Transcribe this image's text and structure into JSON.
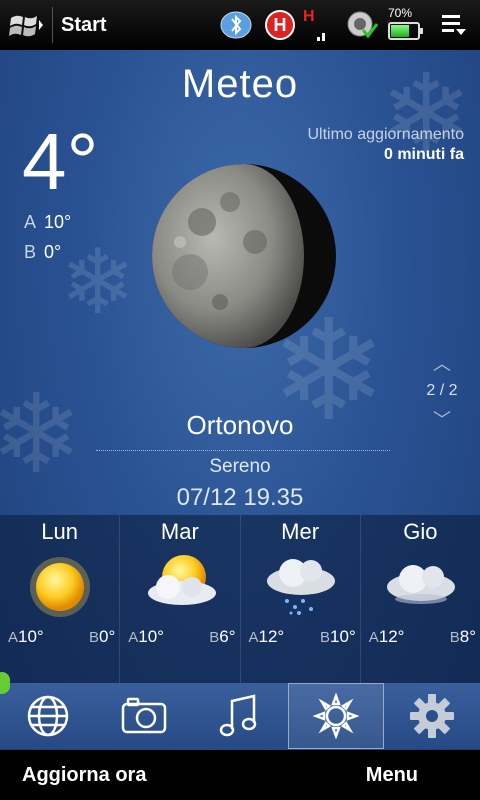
{
  "statusbar": {
    "start_label": "Start",
    "battery_percent": "70%",
    "battery_level": 0.7,
    "icons": [
      "windows-flag-icon",
      "bluetooth-icon",
      "h-signal-icon",
      "signal-bars-icon",
      "sync-icon",
      "battery-icon",
      "menu-icon"
    ]
  },
  "weather": {
    "app_title": "Meteo",
    "current_temp": "4°",
    "high_letter": "A",
    "high": "10°",
    "low_letter": "B",
    "low": "0°",
    "update_label": "Ultimo aggiornamento",
    "update_value": "0 minuti fa",
    "page_indicator": "2 / 2",
    "city": "Ortonovo",
    "condition": "Sereno",
    "datetime": "07/12 19.35"
  },
  "forecast": [
    {
      "day": "Lun",
      "icon": "sun-icon",
      "hi_letter": "A",
      "hi": "10°",
      "lo_letter": "B",
      "lo": "0°"
    },
    {
      "day": "Mar",
      "icon": "partly-cloudy-icon",
      "hi_letter": "A",
      "hi": "10°",
      "lo_letter": "B",
      "lo": "6°"
    },
    {
      "day": "Mer",
      "icon": "rain-cloud-icon",
      "hi_letter": "A",
      "hi": "12°",
      "lo_letter": "B",
      "lo": "10°"
    },
    {
      "day": "Gio",
      "icon": "cloud-icon",
      "hi_letter": "A",
      "hi": "12°",
      "lo_letter": "B",
      "lo": "8°"
    }
  ],
  "iconbar": {
    "items": [
      "globe-icon",
      "camera-icon",
      "music-note-icon",
      "weather-sun-icon",
      "settings-gear-icon"
    ],
    "selected": "weather-sun-icon"
  },
  "softkeys": {
    "left": "Aggiorna ora",
    "right": "Menu"
  }
}
